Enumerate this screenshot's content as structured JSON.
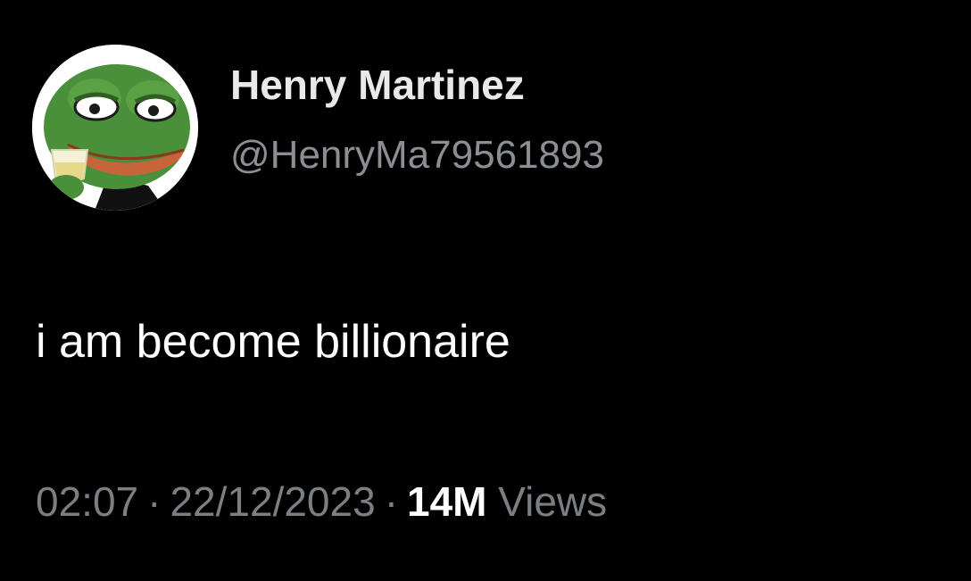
{
  "tweet": {
    "author": {
      "display_name": "Henry Martinez",
      "handle": "@HenryMa79561893"
    },
    "text": "i am become billionaire",
    "meta": {
      "time": "02:07",
      "separator": "·",
      "date": "22/12/2023",
      "views_count": "14M",
      "views_label": "Views"
    }
  },
  "colors": {
    "background": "#000000",
    "name": "#e7e9ea",
    "handle": "#8b8f94",
    "body_text": "#ffffff",
    "meta_text": "#7b7f84",
    "avatar_frog": "#4a8f3a"
  },
  "icons": {
    "avatar": "frog-avatar-icon"
  }
}
